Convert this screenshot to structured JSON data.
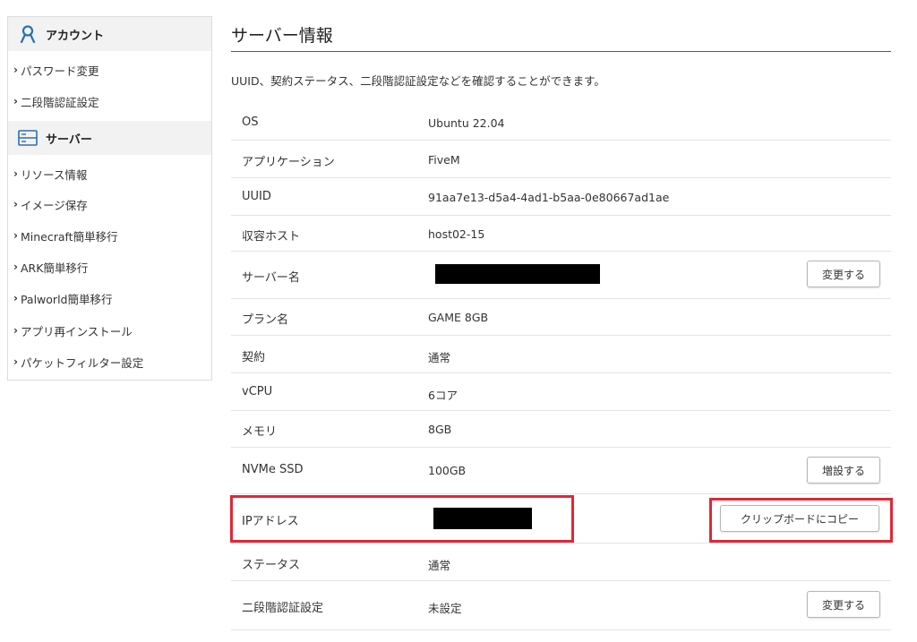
{
  "sidebar": {
    "account": {
      "title": "アカウント",
      "icon": "user-icon",
      "items": [
        {
          "label": "パスワード変更"
        },
        {
          "label": "二段階認証設定"
        }
      ]
    },
    "server": {
      "title": "サーバー",
      "icon": "server-icon",
      "items": [
        {
          "label": "リソース情報"
        },
        {
          "label": "イメージ保存"
        },
        {
          "label": "Minecraft簡単移行"
        },
        {
          "label": "ARK簡単移行"
        },
        {
          "label": "Palworld簡単移行"
        },
        {
          "label": "アプリ再インストール"
        },
        {
          "label": "パケットフィルター設定"
        }
      ]
    }
  },
  "main": {
    "title": "サーバー情報",
    "description": "UUID、契約ステータス、二段階認証設定などを確認することができます。",
    "rows": [
      {
        "label": "OS",
        "value": "Ubuntu 22.04"
      },
      {
        "label": "アプリケーション",
        "value": "FiveM"
      },
      {
        "label": "UUID",
        "value": "91aa7e13-d5a4-4ad1-b5aa-0e80667ad1ae"
      },
      {
        "label": "収容ホスト",
        "value": "host02-15"
      },
      {
        "label": "サーバー名",
        "value": "",
        "redacted": true,
        "button": "変更する"
      },
      {
        "label": "プラン名",
        "value": "GAME 8GB"
      },
      {
        "label": "契約",
        "value": "通常"
      },
      {
        "label": "vCPU",
        "value": "6コア"
      },
      {
        "label": "メモリ",
        "value": "8GB"
      },
      {
        "label": "NVMe SSD",
        "value": "100GB",
        "button": "増設する"
      },
      {
        "label": "IPアドレス",
        "value": "",
        "redacted": true,
        "button": "クリップボードにコピー"
      },
      {
        "label": "ステータス",
        "value": "通常"
      },
      {
        "label": "二段階認証設定",
        "value": "未設定",
        "button": "変更する"
      }
    ]
  },
  "colors": {
    "highlight": "#e32636",
    "sidebar_header_bg": "#f2f2f2",
    "icon_blue": "#2a6fb5"
  }
}
